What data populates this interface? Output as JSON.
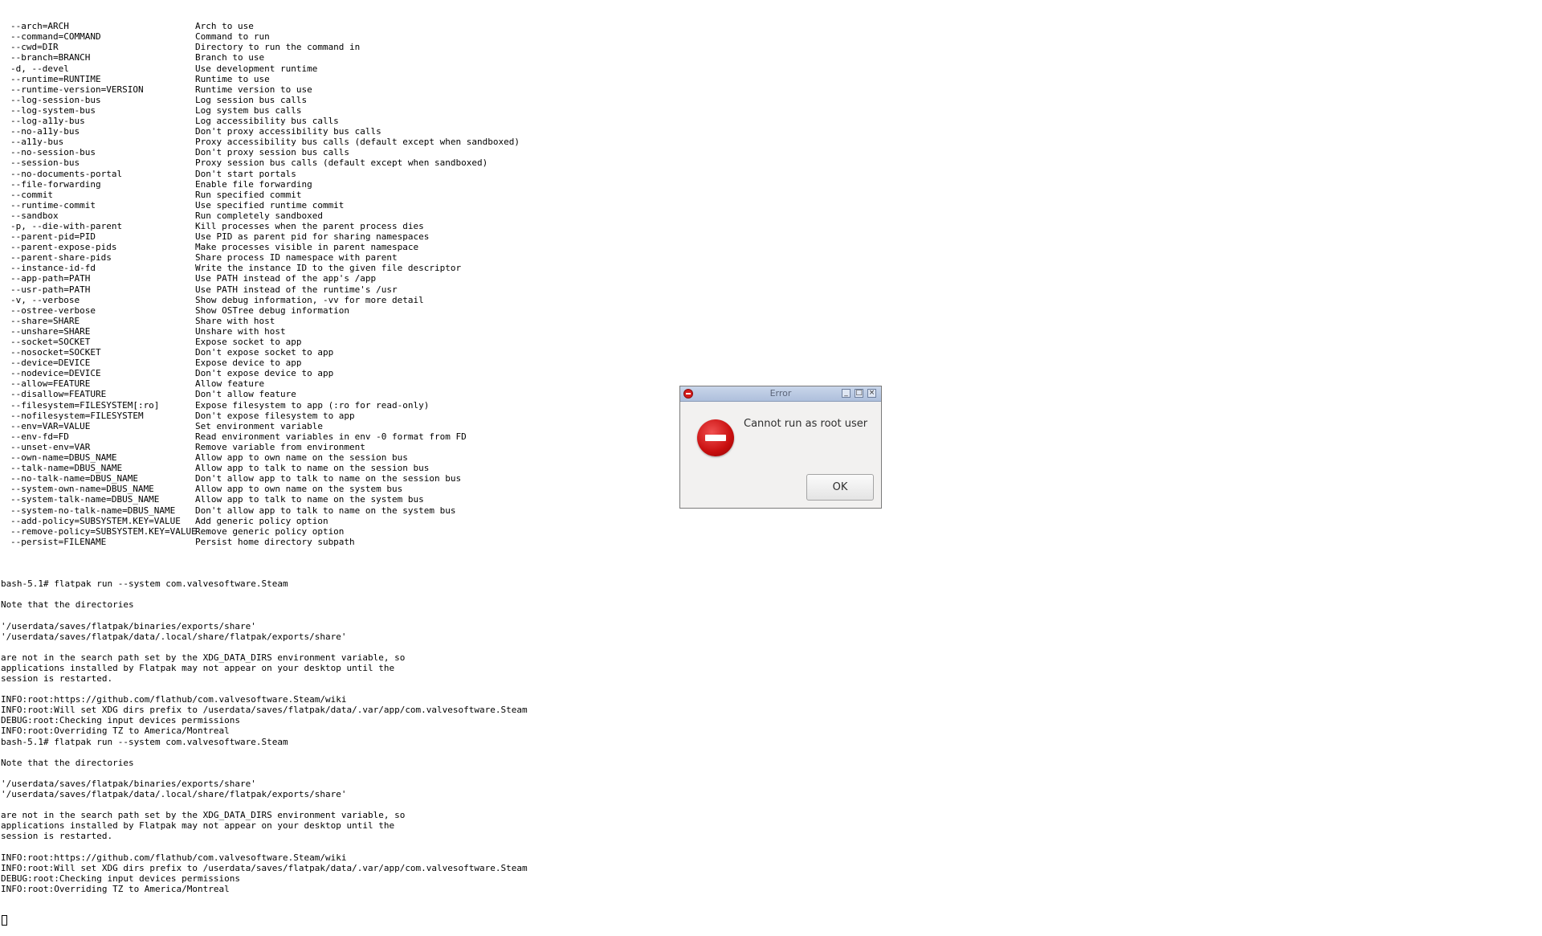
{
  "terminal": {
    "options": [
      {
        "opt": "--arch=ARCH",
        "desc": "Arch to use"
      },
      {
        "opt": "--command=COMMAND",
        "desc": "Command to run"
      },
      {
        "opt": "--cwd=DIR",
        "desc": "Directory to run the command in"
      },
      {
        "opt": "--branch=BRANCH",
        "desc": "Branch to use"
      },
      {
        "opt": "-d, --devel",
        "desc": "Use development runtime"
      },
      {
        "opt": "--runtime=RUNTIME",
        "desc": "Runtime to use"
      },
      {
        "opt": "--runtime-version=VERSION",
        "desc": "Runtime version to use"
      },
      {
        "opt": "--log-session-bus",
        "desc": "Log session bus calls"
      },
      {
        "opt": "--log-system-bus",
        "desc": "Log system bus calls"
      },
      {
        "opt": "--log-a11y-bus",
        "desc": "Log accessibility bus calls"
      },
      {
        "opt": "--no-a11y-bus",
        "desc": "Don't proxy accessibility bus calls"
      },
      {
        "opt": "--a11y-bus",
        "desc": "Proxy accessibility bus calls (default except when sandboxed)"
      },
      {
        "opt": "--no-session-bus",
        "desc": "Don't proxy session bus calls"
      },
      {
        "opt": "--session-bus",
        "desc": "Proxy session bus calls (default except when sandboxed)"
      },
      {
        "opt": "--no-documents-portal",
        "desc": "Don't start portals"
      },
      {
        "opt": "--file-forwarding",
        "desc": "Enable file forwarding"
      },
      {
        "opt": "--commit",
        "desc": "Run specified commit"
      },
      {
        "opt": "--runtime-commit",
        "desc": "Use specified runtime commit"
      },
      {
        "opt": "--sandbox",
        "desc": "Run completely sandboxed"
      },
      {
        "opt": "-p, --die-with-parent",
        "desc": "Kill processes when the parent process dies"
      },
      {
        "opt": "--parent-pid=PID",
        "desc": "Use PID as parent pid for sharing namespaces"
      },
      {
        "opt": "--parent-expose-pids",
        "desc": "Make processes visible in parent namespace"
      },
      {
        "opt": "--parent-share-pids",
        "desc": "Share process ID namespace with parent"
      },
      {
        "opt": "--instance-id-fd",
        "desc": "Write the instance ID to the given file descriptor"
      },
      {
        "opt": "--app-path=PATH",
        "desc": "Use PATH instead of the app's /app"
      },
      {
        "opt": "--usr-path=PATH",
        "desc": "Use PATH instead of the runtime's /usr"
      },
      {
        "opt": "-v, --verbose",
        "desc": "Show debug information, -vv for more detail"
      },
      {
        "opt": "--ostree-verbose",
        "desc": "Show OSTree debug information"
      },
      {
        "opt": "--share=SHARE",
        "desc": "Share with host"
      },
      {
        "opt": "--unshare=SHARE",
        "desc": "Unshare with host"
      },
      {
        "opt": "--socket=SOCKET",
        "desc": "Expose socket to app"
      },
      {
        "opt": "--nosocket=SOCKET",
        "desc": "Don't expose socket to app"
      },
      {
        "opt": "--device=DEVICE",
        "desc": "Expose device to app"
      },
      {
        "opt": "--nodevice=DEVICE",
        "desc": "Don't expose device to app"
      },
      {
        "opt": "--allow=FEATURE",
        "desc": "Allow feature"
      },
      {
        "opt": "--disallow=FEATURE",
        "desc": "Don't allow feature"
      },
      {
        "opt": "--filesystem=FILESYSTEM[:ro]",
        "desc": "Expose filesystem to app (:ro for read-only)"
      },
      {
        "opt": "--nofilesystem=FILESYSTEM",
        "desc": "Don't expose filesystem to app"
      },
      {
        "opt": "--env=VAR=VALUE",
        "desc": "Set environment variable"
      },
      {
        "opt": "--env-fd=FD",
        "desc": "Read environment variables in env -0 format from FD"
      },
      {
        "opt": "--unset-env=VAR",
        "desc": "Remove variable from environment"
      },
      {
        "opt": "--own-name=DBUS_NAME",
        "desc": "Allow app to own name on the session bus"
      },
      {
        "opt": "--talk-name=DBUS_NAME",
        "desc": "Allow app to talk to name on the session bus"
      },
      {
        "opt": "--no-talk-name=DBUS_NAME",
        "desc": "Don't allow app to talk to name on the session bus"
      },
      {
        "opt": "--system-own-name=DBUS_NAME",
        "desc": "Allow app to own name on the system bus"
      },
      {
        "opt": "--system-talk-name=DBUS_NAME",
        "desc": "Allow app to talk to name on the system bus"
      },
      {
        "opt": "--system-no-talk-name=DBUS_NAME",
        "desc": "Don't allow app to talk to name on the system bus"
      },
      {
        "opt": "--add-policy=SUBSYSTEM.KEY=VALUE",
        "desc": "Add generic policy option"
      },
      {
        "opt": "--remove-policy=SUBSYSTEM.KEY=VALUE",
        "desc": "Remove generic policy option"
      },
      {
        "opt": "--persist=FILENAME",
        "desc": "Persist home directory subpath"
      }
    ],
    "output_lines": [
      "",
      "bash-5.1# flatpak run --system com.valvesoftware.Steam",
      "",
      "Note that the directories",
      "",
      "'/userdata/saves/flatpak/binaries/exports/share'",
      "'/userdata/saves/flatpak/data/.local/share/flatpak/exports/share'",
      "",
      "are not in the search path set by the XDG_DATA_DIRS environment variable, so",
      "applications installed by Flatpak may not appear on your desktop until the",
      "session is restarted.",
      "",
      "INFO:root:https://github.com/flathub/com.valvesoftware.Steam/wiki",
      "INFO:root:Will set XDG dirs prefix to /userdata/saves/flatpak/data/.var/app/com.valvesoftware.Steam",
      "DEBUG:root:Checking input devices permissions",
      "INFO:root:Overriding TZ to America/Montreal",
      "bash-5.1# flatpak run --system com.valvesoftware.Steam",
      "",
      "Note that the directories",
      "",
      "'/userdata/saves/flatpak/binaries/exports/share'",
      "'/userdata/saves/flatpak/data/.local/share/flatpak/exports/share'",
      "",
      "are not in the search path set by the XDG_DATA_DIRS environment variable, so",
      "applications installed by Flatpak may not appear on your desktop until the",
      "session is restarted.",
      "",
      "INFO:root:https://github.com/flathub/com.valvesoftware.Steam/wiki",
      "INFO:root:Will set XDG dirs prefix to /userdata/saves/flatpak/data/.var/app/com.valvesoftware.Steam",
      "DEBUG:root:Checking input devices permissions",
      "INFO:root:Overriding TZ to America/Montreal"
    ]
  },
  "dialog": {
    "title": "Error",
    "message": "Cannot run as root user",
    "ok_label": "OK",
    "title_icon": "error-icon",
    "body_icon": "error-icon",
    "accent_color": "#d41c1c"
  }
}
